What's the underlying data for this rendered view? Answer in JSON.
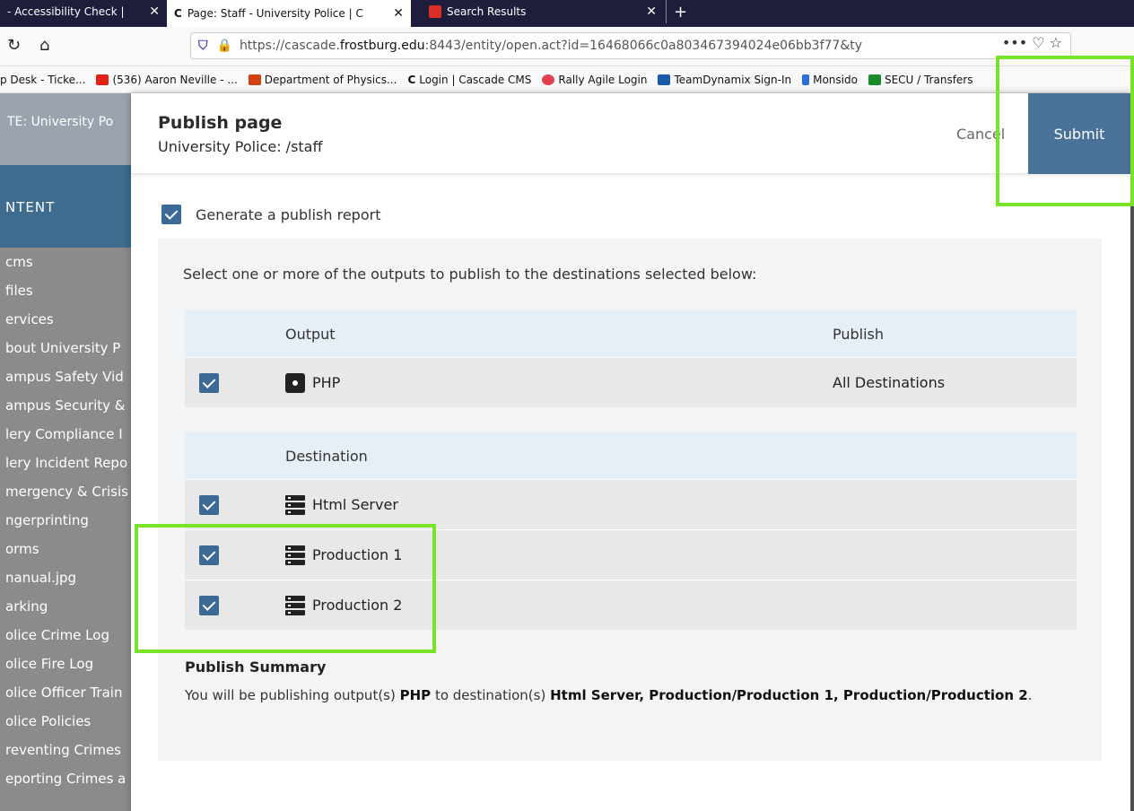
{
  "browser": {
    "tabs": [
      {
        "label": "- Accessibility Check |",
        "close": "✕"
      },
      {
        "label": "Page: Staff - University Police | C",
        "close": "✕"
      },
      {
        "label": "Search Results",
        "close": "✕"
      }
    ],
    "new_tab": "+",
    "url_scheme": "https://cascade.",
    "url_domain": "frostburg.edu",
    "url_rest": ":8443/entity/open.act?id=16468066c0a803467394024e06bb3f77&ty",
    "url_actions": "••• ♡ ☆",
    "bookmarks": [
      {
        "label": "p Desk - Ticke...",
        "color": "#888888"
      },
      {
        "label": "(536) Aaron Neville - ...",
        "color": "#e62117"
      },
      {
        "label": "Department of Physics...",
        "color": "#d04010"
      },
      {
        "label": "Login | Cascade CMS",
        "color": "#333333"
      },
      {
        "label": "Rally Agile Login",
        "color": "#e04050"
      },
      {
        "label": "TeamDynamix Sign-In",
        "color": "#1a5aa8"
      },
      {
        "label": "Monsido",
        "color": "#2a6fdb"
      },
      {
        "label": "SECU / Transfers",
        "color": "#1a8a2a"
      }
    ]
  },
  "background": {
    "site_label": "TE:  University Po",
    "content_header": "NTENT",
    "items": [
      "cms",
      "files",
      "ervices",
      "bout University P",
      "ampus Safety Vid",
      "ampus Security &",
      "lery Compliance I",
      "lery Incident Repo",
      "mergency & Crisis",
      "ngerprinting",
      "orms",
      "nanual.jpg",
      "arking",
      "olice Crime Log",
      "olice Fire Log",
      "olice Officer Train",
      "olice Policies",
      "reventing Crimes",
      "eporting Crimes a"
    ]
  },
  "modal": {
    "title": "Publish page",
    "subtitle": "University Police: /staff",
    "cancel_label": "Cancel",
    "submit_label": "Submit",
    "generate_report_label": "Generate a publish report",
    "instruction": "Select one or more of the outputs to publish to the destinations selected below:",
    "outputs_table": {
      "col_output": "Output",
      "col_publish": "Publish",
      "rows": [
        {
          "name": "PHP",
          "publish": "All Destinations",
          "checked": true
        }
      ]
    },
    "destinations_table": {
      "col_destination": "Destination",
      "rows": [
        {
          "name": "Html Server",
          "checked": true
        },
        {
          "name": "Production 1",
          "checked": true
        },
        {
          "name": "Production 2",
          "checked": true
        }
      ]
    },
    "summary_title": "Publish Summary",
    "summary": {
      "prefix": "You will be publishing output(s) ",
      "output": "PHP",
      "middle": " to destination(s) ",
      "destinations": "Html Server, Production/Production 1, Production/Production 2",
      "suffix": "."
    }
  },
  "colors": {
    "accent": "#4a7197",
    "checkbox": "#3a6a95",
    "highlight": "#7be22a"
  }
}
